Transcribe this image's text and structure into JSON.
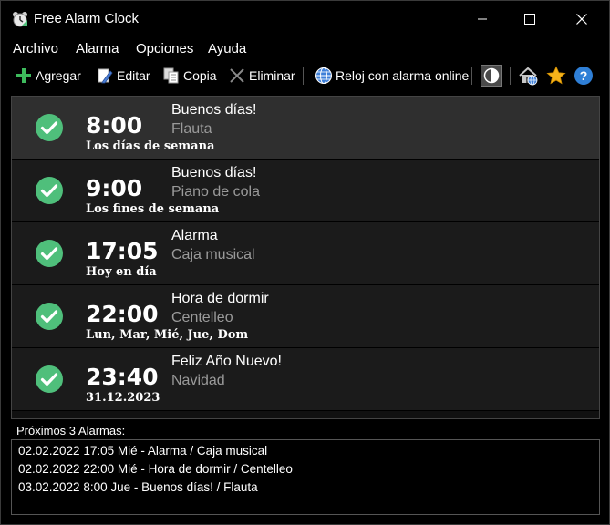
{
  "window": {
    "title": "Free Alarm Clock"
  },
  "menu": [
    "Archivo",
    "Alarma",
    "Opciones",
    "Ayuda"
  ],
  "toolbar": {
    "add": "Agregar",
    "edit": "Editar",
    "copy": "Copia",
    "delete": "Eliminar",
    "online": "Reloj con alarma online"
  },
  "alarms": [
    {
      "time": "8:00",
      "days": "Los días de semana",
      "label": "Buenos días!",
      "sound": "Flauta",
      "enabled": true
    },
    {
      "time": "9:00",
      "days": "Los fines de semana",
      "label": "Buenos días!",
      "sound": "Piano de cola",
      "enabled": true
    },
    {
      "time": "17:05",
      "days": "Hoy en día",
      "label": "Alarma",
      "sound": "Caja musical",
      "enabled": true
    },
    {
      "time": "22:00",
      "days": "Lun, Mar, Mié, Jue, Dom",
      "label": "Hora de dormir",
      "sound": "Centelleo",
      "enabled": true
    },
    {
      "time": "23:40",
      "days": "31.12.2023",
      "label": "Feliz Año Nuevo!",
      "sound": "Navidad",
      "enabled": true
    }
  ],
  "next_alarms": {
    "title": "Próximos 3 Alarmas:",
    "items": [
      "02.02.2022 17:05 Mié - Alarma / Caja musical",
      "02.02.2022 22:00 Mié - Hora de dormir / Centelleo",
      "03.02.2022 8:00 Jue - Buenos días! / Flauta"
    ]
  },
  "colors": {
    "check": "#4fbf7b",
    "background": "#000000",
    "row": "#1b1b1b",
    "row_selected": "#2f2f2f",
    "muted_text": "#9a9a9a"
  },
  "icons": [
    "clock-app-icon",
    "add-icon",
    "edit-icon",
    "copy-icon",
    "delete-icon",
    "globe-icon",
    "contrast-icon",
    "home-icon",
    "star-icon",
    "help-icon",
    "check-icon"
  ]
}
